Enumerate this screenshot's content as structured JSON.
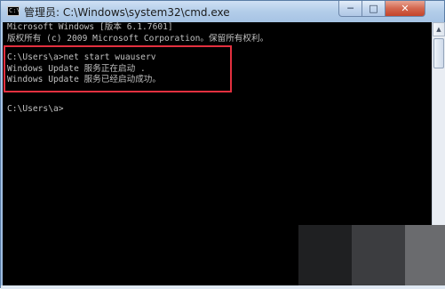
{
  "window": {
    "title": "管理员: C:\\Windows\\system32\\cmd.exe",
    "app_icon": "C:\\",
    "controls": {
      "minimize": "─",
      "maximize": "□",
      "close": "✕"
    }
  },
  "console": {
    "lines": [
      "Microsoft Windows [版本 6.1.7601]",
      "版权所有 (c) 2009 Microsoft Corporation。保留所有权利。",
      "",
      "C:\\Users\\a>net start wuauserv",
      "Windows Update 服务正在启动 .",
      "Windows Update 服务已经启动成功。",
      "",
      "C:\\Users\\a>"
    ]
  },
  "scrollbar": {
    "up_arrow": "▲",
    "down_arrow": "▼"
  },
  "colors": {
    "console_bg": "#000000",
    "console_text": "#c0c0c0",
    "highlight_border": "#e3303f",
    "close_button": "#c4442a"
  }
}
